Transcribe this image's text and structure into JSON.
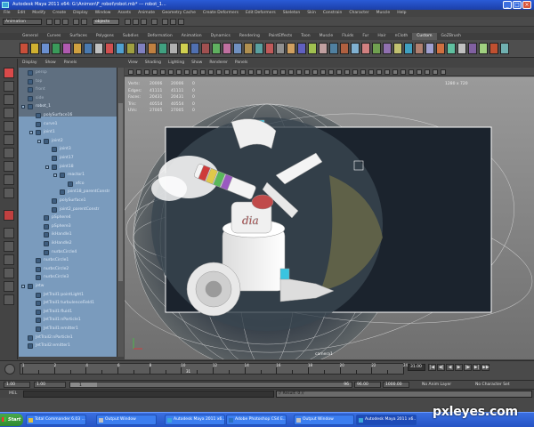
{
  "window": {
    "title": "Autodesk Maya 2011 x64: G:\\Animon\\F_robot\\robot.mb*  ---  robot_1...",
    "controls": [
      "_",
      "□",
      "×"
    ]
  },
  "menubar": [
    "File",
    "Edit",
    "Modify",
    "Create",
    "Display",
    "Window",
    "Assets",
    "Animate",
    "Geometry Cache",
    "Create Deformers",
    "Edit Deformers",
    "Skeleton",
    "Skin",
    "Constrain",
    "Character",
    "Muscle",
    "Help"
  ],
  "statusline": {
    "mode": "Animation",
    "objects": "objects"
  },
  "shelf": {
    "tabs": [
      "General",
      "Curves",
      "Surfaces",
      "Polygons",
      "Subdivs",
      "Deformation",
      "Animation",
      "Dynamics",
      "Rendering",
      "PaintEffects",
      "Toon",
      "Muscle",
      "Fluids",
      "Fur",
      "Hair",
      "nCloth",
      "Custom",
      "GoZBrush"
    ],
    "active_tab": "Custom",
    "icon_colors": [
      "#c94f3a",
      "#d0b030",
      "#6a8fcf",
      "#3a9a5a",
      "#b05ab0",
      "#cfa040",
      "#4a7ab0",
      "#c0c0c0",
      "#d05050",
      "#50a0d0",
      "#a0a040",
      "#8080c0",
      "#c08040",
      "#40a080",
      "#b0b0b0",
      "#d0d050",
      "#5070b0",
      "#a05050",
      "#60b060",
      "#c070a0",
      "#7090c0",
      "#b09050",
      "#5aa0a0",
      "#c05a5a",
      "#909090",
      "#d0a060",
      "#6060c0",
      "#a0c050",
      "#c0a0a0",
      "#5080a0",
      "#b06040",
      "#80b0d0",
      "#d08080",
      "#70a050",
      "#9070b0",
      "#c0c070",
      "#40a0c0",
      "#b08070",
      "#a0a0d0",
      "#d07040",
      "#60c0a0",
      "#c0c0c0",
      "#8060a0",
      "#a0d080",
      "#c05030",
      "#70b0b0"
    ]
  },
  "outliner": {
    "menu": [
      "Display",
      "Show",
      "Panels"
    ],
    "items": [
      {
        "label": "persp",
        "depth": 0,
        "dim": true
      },
      {
        "label": "top",
        "depth": 0,
        "dim": true
      },
      {
        "label": "front",
        "depth": 0,
        "dim": true
      },
      {
        "label": "side",
        "depth": 0,
        "dim": true
      },
      {
        "label": "robot_1",
        "depth": 0,
        "expand": true
      },
      {
        "label": "polySurface16",
        "depth": 1
      },
      {
        "label": "curve1",
        "depth": 1
      },
      {
        "label": "joint1",
        "depth": 1,
        "expand": true
      },
      {
        "label": "joint2",
        "depth": 2,
        "expand": true
      },
      {
        "label": "joint3",
        "depth": 3
      },
      {
        "label": "joint17",
        "depth": 3
      },
      {
        "label": "joint18",
        "depth": 3,
        "expand": true
      },
      {
        "label": "reactor1",
        "depth": 4,
        "expand": true
      },
      {
        "label": "xfco",
        "depth": 5
      },
      {
        "label": "joint18_parentConstr",
        "depth": 4
      },
      {
        "label": "polySurface1",
        "depth": 3
      },
      {
        "label": "joint2_parentConstr",
        "depth": 3
      },
      {
        "label": "pSphere4",
        "depth": 2
      },
      {
        "label": "pSphere3",
        "depth": 2
      },
      {
        "label": "ikHandle1",
        "depth": 2
      },
      {
        "label": "ikHandle2",
        "depth": 2
      },
      {
        "label": "nurbsCircle4",
        "depth": 2
      },
      {
        "label": "nurbsCircle1",
        "depth": 1
      },
      {
        "label": "nurbsCircle2",
        "depth": 1
      },
      {
        "label": "nurbsCircle3",
        "depth": 1
      },
      {
        "label": "jetw",
        "depth": 0,
        "expand": true
      },
      {
        "label": "JetTrail1:pointLight1",
        "depth": 1
      },
      {
        "label": "JetTrail1:turbulenceField1",
        "depth": 1
      },
      {
        "label": "JetTrail1:fluid1",
        "depth": 1
      },
      {
        "label": "JetTrail1:nParticle1",
        "depth": 1
      },
      {
        "label": "JetTrail1:emitter1",
        "depth": 1
      },
      {
        "label": "JetTrail2:nParticle1",
        "depth": 0
      },
      {
        "label": "JetTrail2:emitter1",
        "depth": 0
      }
    ]
  },
  "viewport": {
    "menu": [
      "View",
      "Shading",
      "Lighting",
      "Show",
      "Renderer",
      "Panels"
    ],
    "hud": [
      {
        "label": "Verts:",
        "a": "20006",
        "b": "20006",
        "c": "0"
      },
      {
        "label": "Edges:",
        "a": "41111",
        "b": "41111",
        "c": "0"
      },
      {
        "label": "Faces:",
        "a": "20431",
        "b": "20431",
        "c": "0"
      },
      {
        "label": "Tris:",
        "a": "40554",
        "b": "40554",
        "c": "0"
      },
      {
        "label": "UVs:",
        "a": "27005",
        "b": "27005",
        "c": "0"
      }
    ],
    "resolution": "1280 x 720",
    "camera": "camera1"
  },
  "timeline": {
    "ticks": [
      "1",
      "2",
      "4",
      "6",
      "8",
      "10",
      "12",
      "14",
      "16",
      "18",
      "20",
      "22",
      "24"
    ],
    "current_frame": "31.00",
    "marker_frame": "31",
    "playback_buttons": [
      "|◀",
      "◀|",
      "◀",
      "▶",
      "|▶",
      "▶|",
      "▶▶"
    ]
  },
  "range": {
    "start": "1.00",
    "playback_start": "1.00",
    "slider_label": "1",
    "slider_end": "96",
    "playback_end": "96.00",
    "end": "1000.00",
    "anim_layer": "No Anim Layer",
    "character": "No Character Set"
  },
  "cmdline": {
    "label": "MEL",
    "result": "// Result: 0 //"
  },
  "taskbar": {
    "start": "Start",
    "tasks": [
      {
        "label": "Total Commander 6.03 ...",
        "color": "#e0c040"
      },
      {
        "label": "Output Window",
        "color": "#c0c0c0"
      },
      {
        "label": "Autodesk Maya 2011 x6...",
        "color": "#3aa6d8"
      },
      {
        "label": "Adobe Photoshop CS4 E...",
        "color": "#2a70c0"
      },
      {
        "label": "Output Window",
        "color": "#c0c0c0"
      },
      {
        "label": "Autodesk Maya 2011 x6...",
        "color": "#3aa6d8"
      }
    ]
  },
  "watermark": "pxleyes.com"
}
